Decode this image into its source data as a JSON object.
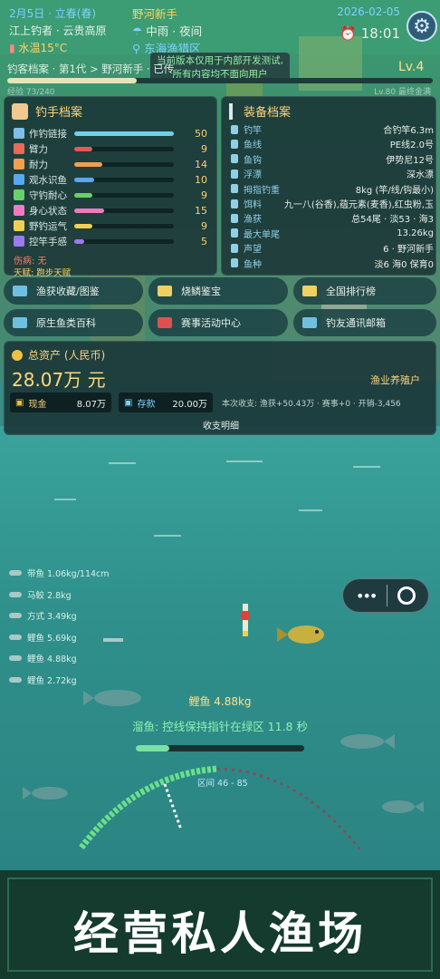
{
  "header": {
    "date_label": "2月5日 · 立春(春)",
    "location_label": "江上钓者 · 云贵高原",
    "water_temp": "水温15°C",
    "player_title": "野河新手",
    "weather": "中雨 · 夜间",
    "area": "东海渔猎区",
    "game_date": "2026-02-05",
    "alarm_time": "18:01",
    "notice_line1": "当前版本仅用于内部开发测试,",
    "notice_line2": "所有内容均不面向用户"
  },
  "level": {
    "path": "钓客档案 · 第1代 > 野河新手 · 已传",
    "level_label": "Lv.4",
    "xp_text": "经验 73/240",
    "xp_fraction": 0.304,
    "max_text": "Lv.80 最终金满"
  },
  "angler_profile": {
    "title": "钓手档案",
    "stats": [
      {
        "label": "作钓链接",
        "value": "50",
        "fraction": 1.0,
        "color": "#6fd0e8",
        "icon": "rod-icon",
        "icon_color": "#7fbfe8"
      },
      {
        "label": "臂力",
        "value": "9",
        "fraction": 0.18,
        "color": "#e05a5a",
        "icon": "arm-icon",
        "icon_color": "#e86a5a"
      },
      {
        "label": "耐力",
        "value": "14",
        "fraction": 0.28,
        "color": "#f0a050",
        "icon": "stamina-icon",
        "icon_color": "#f0a050"
      },
      {
        "label": "观水识鱼",
        "value": "10",
        "fraction": 0.2,
        "color": "#5aa8f0",
        "icon": "eye-icon",
        "icon_color": "#5aa8f0"
      },
      {
        "label": "守钓耐心",
        "value": "9",
        "fraction": 0.18,
        "color": "#6ad06a",
        "icon": "hourglass-icon",
        "icon_color": "#6ad06a"
      },
      {
        "label": "身心状态",
        "value": "15",
        "fraction": 0.3,
        "color": "#f07ac0",
        "icon": "heart-icon",
        "icon_color": "#f07ac0"
      },
      {
        "label": "野钓运气",
        "value": "9",
        "fraction": 0.18,
        "color": "#f0d050",
        "icon": "luck-icon",
        "icon_color": "#f0d050"
      },
      {
        "label": "控竿手感",
        "value": "5",
        "fraction": 0.1,
        "color": "#9a7af0",
        "icon": "hand-icon",
        "icon_color": "#9a7af0"
      }
    ],
    "ailment": "伤病: 无",
    "talent": "天赋: 跑步天赋"
  },
  "equipment": {
    "title": "装备档案",
    "rows": [
      {
        "label": "钓竿",
        "value": "合钓竿6.3m",
        "icon": "rod-icon"
      },
      {
        "label": "鱼线",
        "value": "PE线2.0号",
        "icon": "line-icon"
      },
      {
        "label": "鱼钩",
        "value": "伊势尼12号",
        "icon": "hook-icon"
      },
      {
        "label": "浮漂",
        "value": "深水漂",
        "icon": "float-icon"
      },
      {
        "label": "拇指钓重",
        "value": "8kg (竿/线/钩最小)",
        "icon": "weight-icon"
      },
      {
        "label": "饵料",
        "value": "九一八(谷香),蕴元素(麦香),红虫粉,玉",
        "icon": "bait-icon"
      },
      {
        "label": "渔获",
        "value": "总54尾 · 淡53 · 海3",
        "icon": "catch-icon"
      },
      {
        "label": "最大单尾",
        "value": "13.26kg",
        "icon": "trophy-icon"
      },
      {
        "label": "声望",
        "value": "6 · 野河新手",
        "icon": "fame-icon"
      },
      {
        "label": "鱼种",
        "value": "淡6 海0 保育0",
        "icon": "species-icon"
      }
    ]
  },
  "actions": [
    {
      "label": "渔获收藏/图鉴",
      "icon": "book-icon"
    },
    {
      "label": "烧鳞鉴宝",
      "icon": "gem-icon"
    },
    {
      "label": "全国排行榜",
      "icon": "trophy-icon"
    },
    {
      "label": "原生鱼类百科",
      "icon": "fish-book-icon"
    },
    {
      "label": "赛事活动中心",
      "icon": "cup-icon"
    },
    {
      "label": "钓友通讯邮箱",
      "icon": "mail-icon"
    }
  ],
  "assets": {
    "title": "总资产 (人民币)",
    "total": "28.07万 元",
    "cash_label": "现金",
    "cash_value": "8.07万",
    "deposit_label": "存款",
    "deposit_value": "20.00万",
    "summary": "本次收支: 渔获+50.43万 · 赛事+0 · 开销-3,456",
    "farm_label": "渔业养殖户",
    "collapse_label": "收支明细"
  },
  "catch_list": [
    {
      "text": "带鱼 1.06kg/114cm"
    },
    {
      "text": "马鲛 2.8kg"
    },
    {
      "text": "方式 3.49kg"
    },
    {
      "text": "鲤鱼 5.69kg"
    },
    {
      "text": "鲤鱼 4.88kg"
    },
    {
      "text": "鲤鱼 2.72kg"
    }
  ],
  "fight": {
    "fish_name": "鲤鱼 4.88kg",
    "hint": "溜鱼: 控线保持指针在绿区 11.8 秒",
    "tension_fraction": 0.2,
    "range_text": "区间 46 - 85"
  },
  "banner": {
    "text": "经营私人渔场"
  },
  "colors": {
    "accent_gold": "#ffd37a",
    "hint_green": "#8ff0b0"
  }
}
